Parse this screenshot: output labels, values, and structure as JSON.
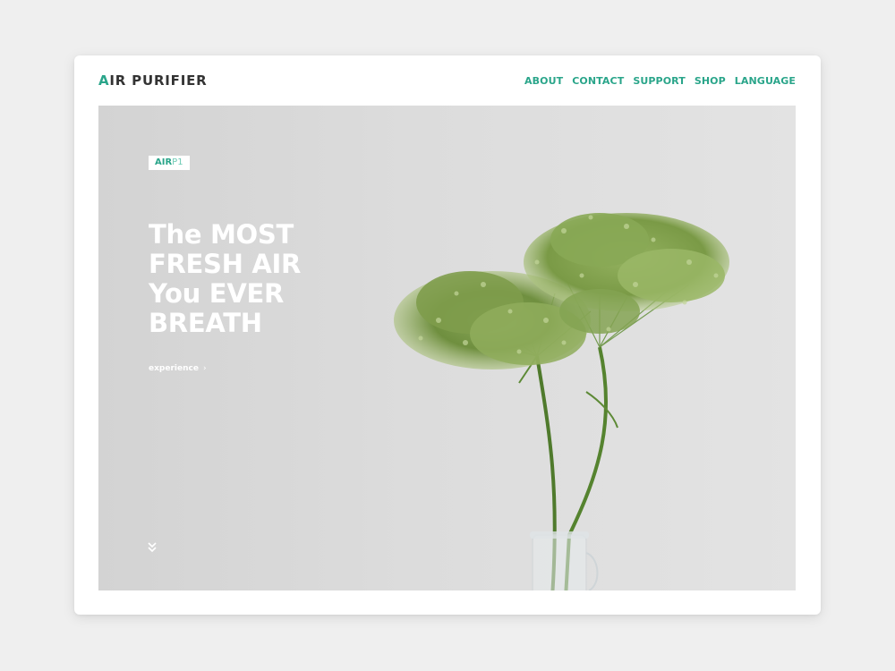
{
  "brand": {
    "accent_letter": "A",
    "rest": "IR PURIFIER",
    "accent_color": "#2aa58a"
  },
  "nav": [
    {
      "label": "ABOUT"
    },
    {
      "label": "CONTACT"
    },
    {
      "label": "SUPPORT"
    },
    {
      "label": "SHOP"
    },
    {
      "label": "LANGUAGE"
    }
  ],
  "hero": {
    "badge": {
      "strong": "AIR",
      "light": "P1"
    },
    "headline": [
      "The MOST",
      "FRESH AIR",
      "You EVER",
      "BREATH"
    ],
    "cta_label": "experience",
    "cta_icon": "chevron-right-icon",
    "scroll_icon": "double-chevron-down-icon",
    "image": "flower-in-vase"
  }
}
